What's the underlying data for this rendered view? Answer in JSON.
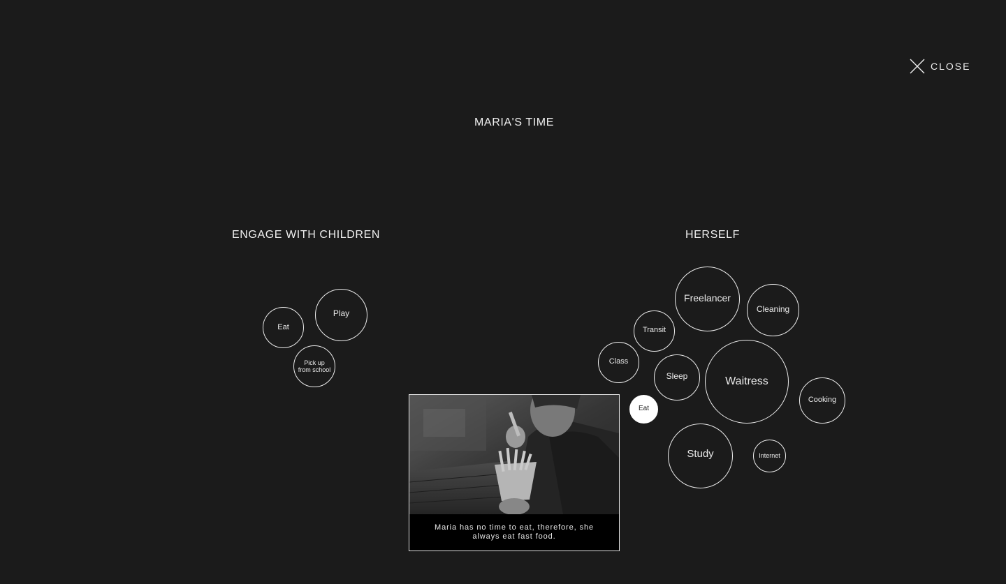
{
  "close": {
    "label": "CLOSE"
  },
  "title": "MARIA'S TIME",
  "groups": {
    "children": {
      "title": "ENGAGE WITH CHILDREN",
      "bubbles": {
        "eat": "Eat",
        "play": "Play",
        "pickup": "Pick up\nfrom school"
      }
    },
    "herself": {
      "title": "HERSELF",
      "bubbles": {
        "freelancer": "Freelancer",
        "cleaning": "Cleaning",
        "transit": "Transit",
        "class": "Class",
        "sleep": "Sleep",
        "waitress": "Waitress",
        "cooking": "Cooking",
        "eat": "Eat",
        "study": "Study",
        "internet": "Internet"
      },
      "active": "eat"
    }
  },
  "popup": {
    "caption": "Maria has no time to eat, therefore, she always eat fast food."
  },
  "colors": {
    "background": "#1b1b1b",
    "stroke": "#ececec",
    "active_fill": "#ffffff"
  }
}
